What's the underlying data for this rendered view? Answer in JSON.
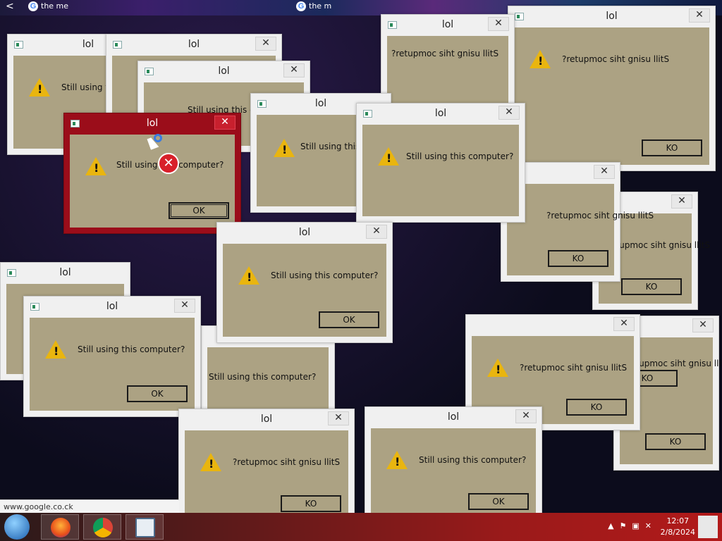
{
  "browser": {
    "tabs": [
      "the me",
      "the m"
    ],
    "back_glyph": "<",
    "tab_icon": "google-icon"
  },
  "status_url": "www.google.co.ck",
  "dialog_title": "lol",
  "messages": {
    "normal": "Still using this computer?",
    "reversed": "?retupmoc siht gnisu llitS"
  },
  "buttons": {
    "ok": "OK",
    "ok_reversed": "KO"
  },
  "windows": [
    {
      "title": "lol",
      "message": "Still using this computer?",
      "button": "OK"
    },
    {
      "title": "lol",
      "message": "?retupmoc siht gnisu llitS",
      "button": "KO"
    },
    {
      "title": "lol",
      "message": "Still using this computer?",
      "button": "OK"
    },
    {
      "title": "lol",
      "message": "?retupmoc siht gnisu llitS",
      "button": "KO"
    },
    {
      "title": "lol",
      "message": "Still using this computer?",
      "button": "OK"
    },
    {
      "title": "lol",
      "message": "?retupmoc siht gnisu llitS",
      "button": "KO"
    },
    {
      "title": "lol",
      "message": "Still using this computer?",
      "button": "OK"
    },
    {
      "title": "lol",
      "message": "?retupmoc siht gnisu llitS",
      "button": "KO"
    },
    {
      "title": "lol",
      "message": "Still using this computer?",
      "button": "OK"
    },
    {
      "title": "lol",
      "message": "Still using this computer?",
      "button": "OK"
    },
    {
      "title": "lol",
      "message": "?retupmoc siht gnisu llitS",
      "button": "KO"
    },
    {
      "title": "lol",
      "message": "Still using this computer?",
      "button": "OK"
    },
    {
      "title": "lol",
      "message": "?retupmoc siht gnisu llitS",
      "button": "KO"
    },
    {
      "title": "lol",
      "message": "Still using this computer?",
      "button": "OK"
    },
    {
      "title": "lol",
      "message": "?retupmoc siht gnisu llitS",
      "button": "KO"
    },
    {
      "title": "lol",
      "message": "Still using this computer?",
      "button": "OK"
    }
  ],
  "taskbar": {
    "apps": [
      "firefox-icon",
      "chrome-icon",
      "app-icon"
    ],
    "time": "12:07",
    "date": "2/8/2024",
    "accent": "#9a1a1a"
  }
}
